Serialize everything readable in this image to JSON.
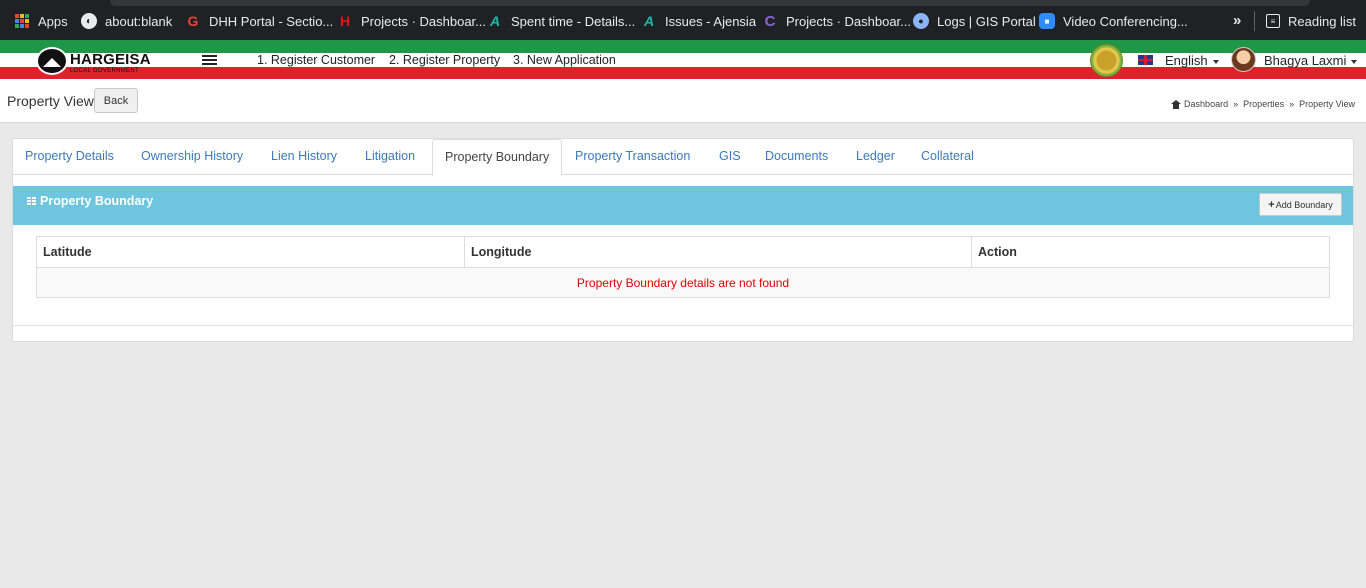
{
  "browser": {
    "bookmarks": [
      {
        "label": "Apps",
        "icon": "apps-grid-icon"
      },
      {
        "label": "about:blank",
        "icon": "globe-icon"
      },
      {
        "label": "DHH Portal - Sectio...",
        "icon": "g-letter-icon"
      },
      {
        "label": "Projects · Dashboar...",
        "icon": "h-letter-icon"
      },
      {
        "label": "Spent time - Details...",
        "icon": "a-letter-icon"
      },
      {
        "label": "Issues - Ajensia",
        "icon": "a-letter-icon"
      },
      {
        "label": "Projects · Dashboar...",
        "icon": "c-letter-icon"
      },
      {
        "label": "Logs | GIS Portal",
        "icon": "gis-icon"
      },
      {
        "label": "Video Conferencing...",
        "icon": "video-icon"
      }
    ],
    "more_label": "»",
    "reading_list_label": "Reading list"
  },
  "header": {
    "logo_name": "HARGEISA",
    "logo_subtitle": "LOCAL GOVERNMENT",
    "nav": [
      "1. Register Customer",
      "2. Register Property",
      "3. New Application"
    ],
    "language": "English",
    "user_name": "Bhagya Laxmi"
  },
  "titlebar": {
    "title": "Property View",
    "back_label": "Back",
    "breadcrumb": [
      "Dashboard",
      "Properties",
      "Property View"
    ],
    "breadcrumb_sep": "»"
  },
  "tabs": [
    {
      "label": "Property Details"
    },
    {
      "label": "Ownership History"
    },
    {
      "label": "Lien History"
    },
    {
      "label": "Litigation"
    },
    {
      "label": "Property Boundary",
      "active": true
    },
    {
      "label": "Property Transaction"
    },
    {
      "label": "GIS"
    },
    {
      "label": "Documents"
    },
    {
      "label": "Ledger"
    },
    {
      "label": "Collateral"
    }
  ],
  "boundary": {
    "title": "Property Boundary",
    "add_label": "Add Boundary",
    "columns": [
      "Latitude",
      "Longitude",
      "Action"
    ],
    "empty_message": "Property Boundary details are not found"
  },
  "colors": {
    "accent": "#6ec6de",
    "link": "#3c7ab8",
    "error": "#e00000",
    "flag_green": "#1e9846",
    "flag_red": "#e0202a"
  }
}
